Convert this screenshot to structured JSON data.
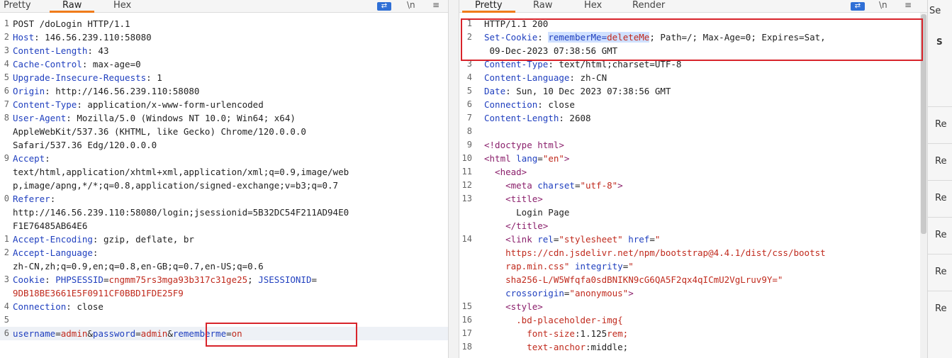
{
  "request": {
    "tabs": [
      "Pretty",
      "Raw",
      "Hex"
    ],
    "active_tab": "Raw",
    "tools": {
      "ln": "\\n",
      "menu": "≡"
    },
    "lines": [
      {
        "num": "1",
        "text": "POST /doLogin HTTP/1.1"
      },
      {
        "num": "2",
        "key": "Host",
        "val": " 146.56.239.110:58080"
      },
      {
        "num": "3",
        "key": "Content-Length",
        "val": " 43"
      },
      {
        "num": "4",
        "key": "Cache-Control",
        "val": " max-age=0"
      },
      {
        "num": "5",
        "key": "Upgrade-Insecure-Requests",
        "val": " 1"
      },
      {
        "num": "6",
        "key": "Origin",
        "val": " http://146.56.239.110:58080"
      },
      {
        "num": "7",
        "key": "Content-Type",
        "val": " application/x-www-form-urlencoded"
      },
      {
        "num": "8",
        "key": "User-Agent",
        "val": " Mozilla/5.0 (Windows NT 10.0; Win64; x64)"
      },
      {
        "num": "",
        "text": "AppleWebKit/537.36 (KHTML, like Gecko) Chrome/120.0.0.0"
      },
      {
        "num": "",
        "text": "Safari/537.36 Edg/120.0.0.0"
      },
      {
        "num": "9",
        "key": "Accept",
        "val": ""
      },
      {
        "num": "",
        "text": "text/html,application/xhtml+xml,application/xml;q=0.9,image/web"
      },
      {
        "num": "",
        "text": "p,image/apng,*/*;q=0.8,application/signed-exchange;v=b3;q=0.7"
      },
      {
        "num": "0",
        "key": "Referer",
        "val": ""
      },
      {
        "num": "",
        "text": "http://146.56.239.110:58080/login;jsessionid=5B32DC54F211AD94E0"
      },
      {
        "num": "",
        "text": "F1E76485AB64E6"
      },
      {
        "num": "1",
        "key": "Accept-Encoding",
        "val": " gzip, deflate, br"
      },
      {
        "num": "2",
        "key": "Accept-Language",
        "val": ""
      },
      {
        "num": "",
        "text": "zh-CN,zh;q=0.9,en;q=0.8,en-GB;q=0.7,en-US;q=0.6"
      },
      {
        "num": "3",
        "cookie": true
      },
      {
        "num": "",
        "text": "9DB18BE3661E5F0911CF0BBD1FDE25F9",
        "red": true
      },
      {
        "num": "4",
        "key": "Connection",
        "val": " close"
      },
      {
        "num": "5",
        "text": ""
      },
      {
        "num": "6",
        "body": true
      }
    ],
    "cookie": {
      "key": "Cookie",
      "n1": "PHPSESSID",
      "v1": "cngmm75rs3mga93b317c31ge25",
      "n2": "JSESSIONID"
    },
    "body": {
      "k1": "username",
      "v1": "admin",
      "k2": "password",
      "v2": "admin",
      "k3": "rememberme",
      "v3": "on"
    }
  },
  "response": {
    "tabs": [
      "Pretty",
      "Raw",
      "Hex",
      "Render"
    ],
    "active_tab": "Pretty",
    "tools": {
      "ln": "\\n",
      "menu": "≡"
    },
    "lines": [
      {
        "num": "1",
        "text": "HTTP/1.1 200"
      },
      {
        "num": "2",
        "setcookie": true
      },
      {
        "num": "",
        "text": " 09-Dec-2023 07:38:56 GMT"
      },
      {
        "num": "3",
        "key": "Content-Type",
        "val": " text/html;charset=UTF-8"
      },
      {
        "num": "4",
        "key": "Content-Language",
        "val": " zh-CN"
      },
      {
        "num": "5",
        "key": "Date",
        "val": " Sun, 10 Dec 2023 07:38:56 GMT"
      },
      {
        "num": "6",
        "key": "Connection",
        "val": " close"
      },
      {
        "num": "7",
        "key": "Content-Length",
        "val": " 2608"
      },
      {
        "num": "8",
        "text": ""
      },
      {
        "num": "9",
        "markup": "<!doctype html>"
      },
      {
        "num": "10",
        "html": true
      },
      {
        "num": "11",
        "markup": "  <head>"
      },
      {
        "num": "12",
        "meta": true
      },
      {
        "num": "13",
        "markup": "    <title>"
      },
      {
        "num": "",
        "text": "      Login Page"
      },
      {
        "num": "",
        "markup": "    </title>"
      },
      {
        "num": "14",
        "link": true
      },
      {
        "num": "",
        "text": "    https://cdn.jsdelivr.net/npm/bootstrap@4.4.1/dist/css/bootst",
        "red": true
      },
      {
        "num": "",
        "link2": true
      },
      {
        "num": "",
        "text": "    sha256-L/W5Wfqfa0sdBNIKN9cG6QA5F2qx4qICmU2VgLruv9Y=\"",
        "red": true
      },
      {
        "num": "",
        "link3": true
      },
      {
        "num": "15",
        "markup": "    <style>"
      },
      {
        "num": "16",
        "text": "      .bd-placeholder-img{",
        "red": true
      },
      {
        "num": "17",
        "css1": true
      },
      {
        "num": "18",
        "css2": true
      }
    ],
    "setcookie": {
      "key": "Set-Cookie",
      "name": "rememberMe",
      "eq": "=",
      "value": "deleteMe",
      "rest": "; Path=/; Max-Age=0; Expires=Sat,"
    },
    "html_lang": {
      "tag": "<html",
      "attr": " lang",
      "val": "\"en\"",
      "close": ">"
    },
    "meta": {
      "tag": "    <meta",
      "attr": " charset",
      "val": "\"utf-8\"",
      "close": ">"
    },
    "link": {
      "tag": "    <link",
      "a1": " rel",
      "v1": "\"stylesheet\"",
      "a2": " href",
      "v2": "\""
    },
    "link2": {
      "v": "    rap.min.css\"",
      "a": " integrity",
      "v2": "\""
    },
    "link3": {
      "a": "    crossorigin",
      "v": "\"anonymous\"",
      "close": ">"
    },
    "css1": {
      "p": "        font-size",
      "v": ":1.125",
      "u": "rem;"
    },
    "css2": {
      "p": "        text-anchor",
      "v": ":middle;"
    }
  },
  "side": {
    "top_label": "Se",
    "items": [
      "Re",
      "Re",
      "Re",
      "Re",
      "Re",
      "Re"
    ]
  }
}
